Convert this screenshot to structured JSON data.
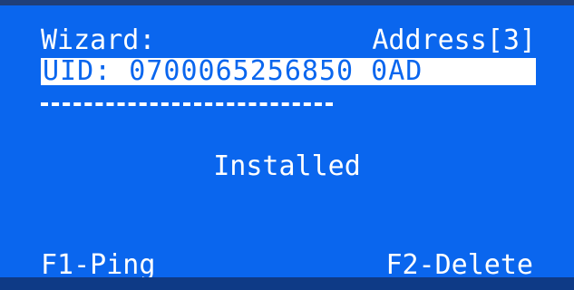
{
  "header": {
    "title": "Wizard:",
    "address": "Address[3]"
  },
  "uid_line": "UID: 0700065256850 0AD",
  "status": "Installed",
  "softkeys": {
    "f1": "F1-Ping",
    "f2": "F2-Delete"
  },
  "colors": {
    "background": "#0a66ee",
    "text": "#ffffff"
  }
}
